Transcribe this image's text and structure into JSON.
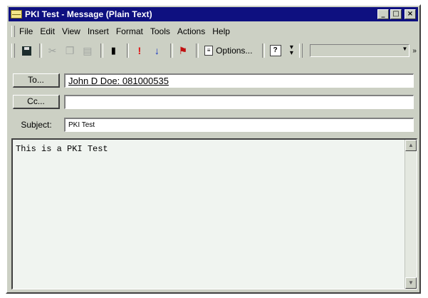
{
  "window": {
    "title": "PKI Test - Message (Plain Text)",
    "min_symbol": "_",
    "max_symbol": "□",
    "close_symbol": "×"
  },
  "menu": {
    "items": [
      {
        "label": "File"
      },
      {
        "label": "Edit"
      },
      {
        "label": "View"
      },
      {
        "label": "Insert"
      },
      {
        "label": "Format"
      },
      {
        "label": "Tools"
      },
      {
        "label": "Actions"
      },
      {
        "label": "Help"
      }
    ]
  },
  "toolbar": {
    "options_label": "Options...",
    "importance_high_glyph": "!",
    "importance_low_glyph": "↓",
    "flag_glyph": "⚑",
    "help_glyph": "?",
    "more_glyph": "»",
    "icons": [
      "save-icon",
      "cut-icon",
      "copy-icon",
      "paste-icon",
      "attach-icon",
      "importance-high-icon",
      "importance-low-icon",
      "flag-icon",
      "options-icon",
      "help-icon"
    ]
  },
  "header": {
    "to_label": "To...",
    "cc_label": "Cc...",
    "subject_label": "Subject:",
    "to_value": "John D Doe: 081000535",
    "cc_value": "",
    "subject_value": "PKI Test"
  },
  "body": {
    "text": "This is a PKI Test"
  },
  "colors": {
    "titlebar": "#0e1080",
    "window_bg": "#ccd0c4",
    "body_bg": "#f0f4f0"
  }
}
